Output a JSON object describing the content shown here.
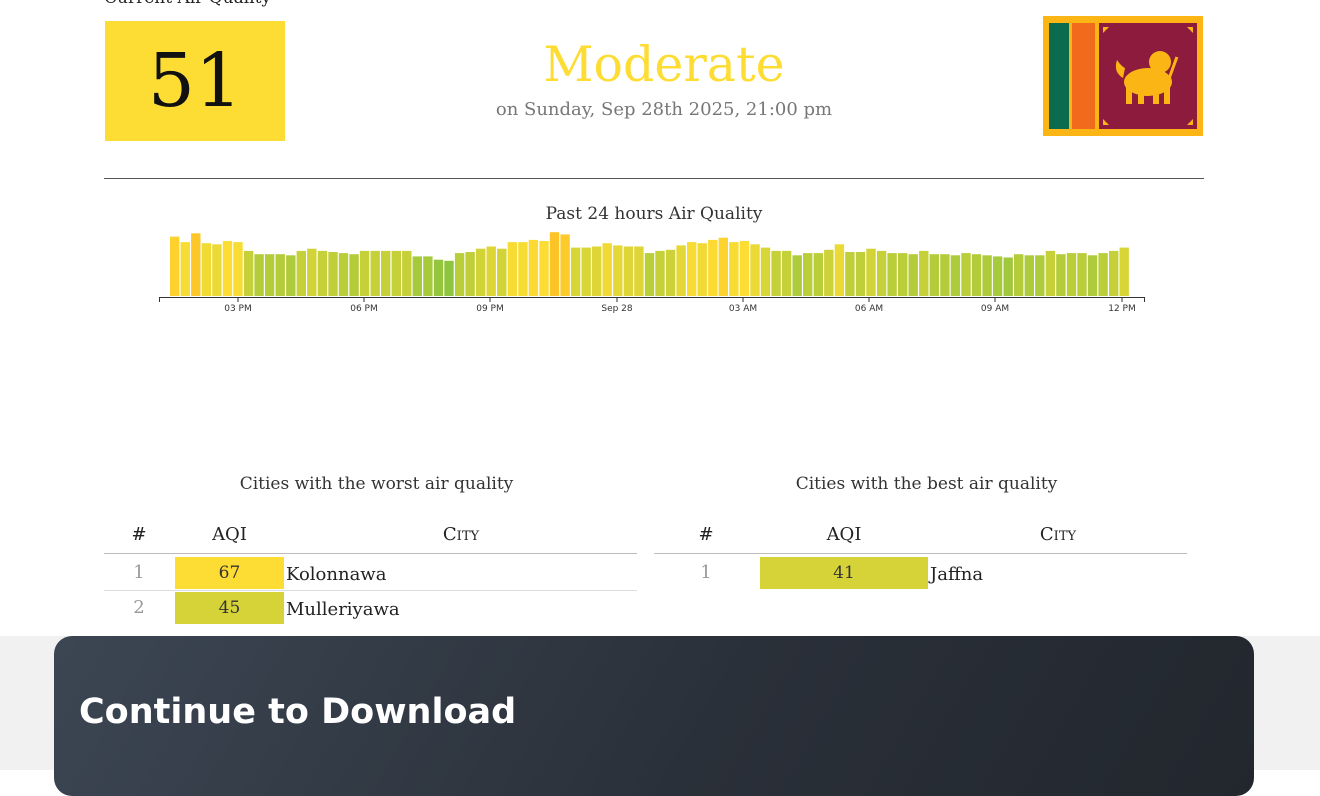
{
  "header": {
    "heading": "Current Air Quality",
    "aqi": "51",
    "status": "Moderate",
    "status_color": "#fddd33",
    "datetime": "on Sunday, Sep 28th 2025, 21:00 pm",
    "flag": "sri-lanka-flag"
  },
  "chart_data": {
    "type": "bar",
    "title": "Past 24 hours Air Quality",
    "xlabel": "",
    "ylabel": "",
    "x_tick_labels": [
      "03 PM",
      "06 PM",
      "09 PM",
      "Sep 28",
      "03 AM",
      "06 AM",
      "09 AM",
      "12 PM"
    ],
    "values": [
      54,
      49,
      57,
      48,
      47,
      50,
      49,
      41,
      38,
      38,
      38,
      37,
      41,
      43,
      41,
      40,
      39,
      38,
      41,
      41,
      41,
      41,
      41,
      36,
      36,
      33,
      32,
      39,
      40,
      43,
      45,
      43,
      49,
      49,
      51,
      50,
      58,
      56,
      44,
      44,
      45,
      48,
      46,
      45,
      45,
      39,
      41,
      42,
      46,
      49,
      48,
      51,
      53,
      49,
      50,
      47,
      44,
      41,
      41,
      37,
      39,
      39,
      42,
      47,
      40,
      40,
      43,
      41,
      39,
      39,
      38,
      41,
      38,
      38,
      37,
      39,
      38,
      37,
      36,
      35,
      38,
      37,
      37,
      41,
      38,
      39,
      39,
      37,
      39,
      41,
      44
    ],
    "color_scale": {
      "good": "#8fc43e",
      "moderate": "#fddd33"
    },
    "ylim": [
      0,
      60
    ]
  },
  "worst": {
    "title": "Cities with the worst air quality",
    "headers": {
      "rank": "#",
      "aqi": "AQI",
      "city": "City"
    },
    "rows": [
      {
        "rank": "1",
        "aqi": "67",
        "city": "Kolonnawa",
        "color": "#fddd33"
      },
      {
        "rank": "2",
        "aqi": "45",
        "city": "Mulleriyawa",
        "color": "#d6d338"
      }
    ]
  },
  "best": {
    "title": "Cities with the best air quality",
    "headers": {
      "rank": "#",
      "aqi": "AQI",
      "city": "City"
    },
    "rows": [
      {
        "rank": "1",
        "aqi": "41",
        "city": "Jaffna",
        "color": "#d6d338"
      }
    ]
  },
  "footer": {
    "title": "Continue to Download"
  }
}
